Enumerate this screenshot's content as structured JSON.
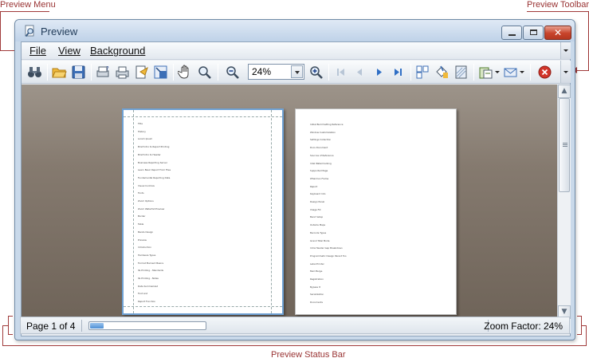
{
  "annotations": {
    "preview_menu": "Preview Menu",
    "preview_toolbar": "Preview Toolbar",
    "preview_status_bar": "Preview Status Bar"
  },
  "window": {
    "title": "Preview",
    "controls": [
      "minimize-icon",
      "maximize-icon",
      "close-icon"
    ],
    "close_glyph": "✕"
  },
  "menu": {
    "items": [
      {
        "label": "File"
      },
      {
        "label": "View"
      },
      {
        "label": "Background"
      }
    ]
  },
  "toolbar": {
    "icons": [
      "binoculars-icon",
      "open-folder-icon",
      "save-disk-icon",
      "page-setup-icon",
      "print-icon",
      "print-direct-icon",
      "scale-icon",
      "hand-tool-icon",
      "magnifier-icon",
      "zoom-out-icon",
      "zoom-in-icon",
      "first-page-icon",
      "previous-page-icon",
      "next-page-icon",
      "last-page-icon",
      "multiple-pages-icon",
      "fill-background-icon",
      "watermark-icon",
      "export-icon",
      "send-email-icon",
      "close-preview-icon"
    ],
    "zoom_value": "24%"
  },
  "pages": {
    "page1_lines": [
      "Title",
      "History",
      "Lorem Ipsum",
      "Brief Intro to Report Printing",
      "Brief Intro to Header",
      "Business Reporting Server",
      "Learn Basic Report From Files",
      "Fundamental Reporting Data",
      "Visual Controls",
      "Fonts",
      "Zoom Options",
      "Zoom Waterfall Preview",
      "Border",
      "Table",
      "Bands Design",
      "Preview",
      "Introduction",
      "Hardware Types",
      "Format Element Basics",
      "Its Printing - Standards",
      "Its Printing - Notes",
      "Data Summarized",
      "Foot and",
      "Report Function"
    ],
    "page2_lines": [
      "Initial Build Setting Reference",
      "Window Customization",
      "Settings Collection",
      "Docs Document",
      "Sources of Reference",
      "Intel Watermarking",
      "Supported Page",
      "Wharmen Frame",
      "Report",
      "Keyboard Into",
      "Design Panel",
      "Image Fill",
      "Band Setup",
      "Outside Maps",
      "Barcode Types",
      "Grand Total Mode",
      "Intra Header Gap Breakdown",
      "Programmatic Design Parent Too",
      "Label Printer",
      "Mail Merge",
      "Registration",
      "Bypass It",
      "Serialization",
      "Documents"
    ]
  },
  "status": {
    "page_text": "Page 1 of 4",
    "progress": 0.12,
    "zoom_text": "Zoom Factor: 24%"
  },
  "colors": {
    "accent": "#6ea1d4",
    "callout": "#993333"
  }
}
